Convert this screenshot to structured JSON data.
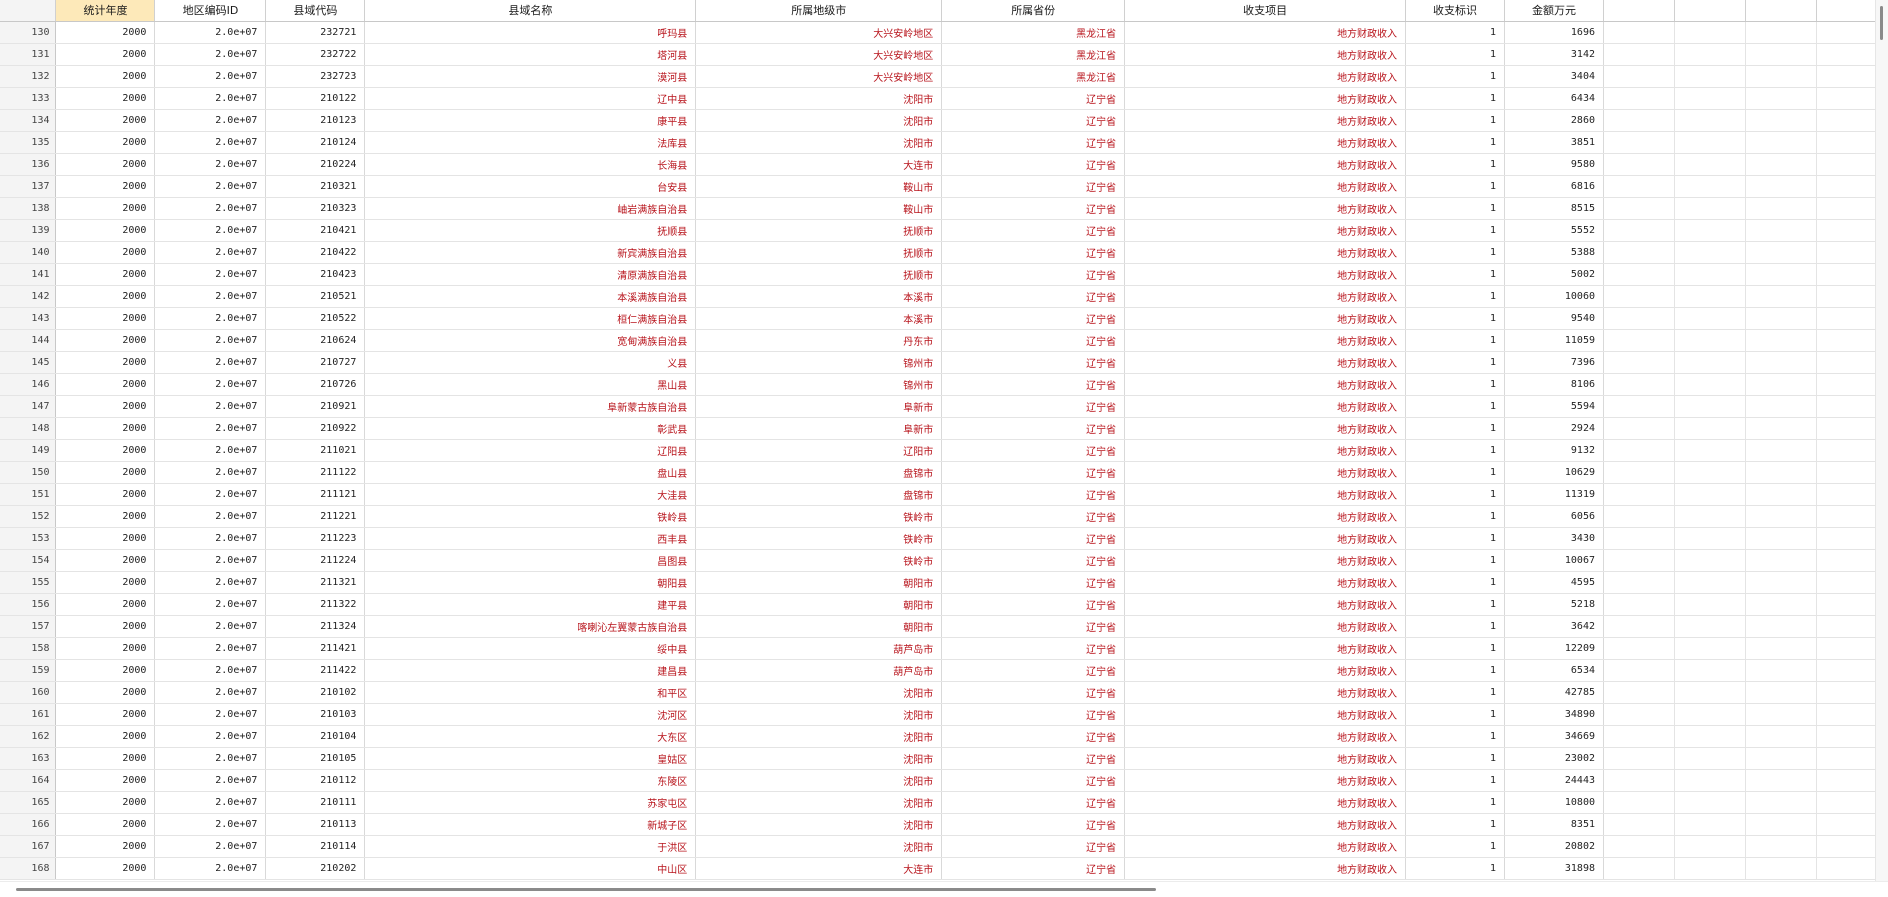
{
  "columns": [
    {
      "label": "统计年度",
      "kind": "num",
      "selected": true
    },
    {
      "label": "地区编码ID",
      "kind": "num"
    },
    {
      "label": "县域代码",
      "kind": "num"
    },
    {
      "label": "县域名称",
      "kind": "str"
    },
    {
      "label": "所属地级市",
      "kind": "str"
    },
    {
      "label": "所属省份",
      "kind": "str"
    },
    {
      "label": "收支项目",
      "kind": "str"
    },
    {
      "label": "收支标识",
      "kind": "num"
    },
    {
      "label": "金额万元",
      "kind": "num"
    }
  ],
  "extra_blank_columns": 4,
  "rows": [
    [
      "130",
      "2000",
      "2.0e+07",
      "232721",
      "呼玛县",
      "大兴安岭地区",
      "黑龙江省",
      "地方财政收入",
      "1",
      "1696"
    ],
    [
      "131",
      "2000",
      "2.0e+07",
      "232722",
      "塔河县",
      "大兴安岭地区",
      "黑龙江省",
      "地方财政收入",
      "1",
      "3142"
    ],
    [
      "132",
      "2000",
      "2.0e+07",
      "232723",
      "漠河县",
      "大兴安岭地区",
      "黑龙江省",
      "地方财政收入",
      "1",
      "3404"
    ],
    [
      "133",
      "2000",
      "2.0e+07",
      "210122",
      "辽中县",
      "沈阳市",
      "辽宁省",
      "地方财政收入",
      "1",
      "6434"
    ],
    [
      "134",
      "2000",
      "2.0e+07",
      "210123",
      "康平县",
      "沈阳市",
      "辽宁省",
      "地方财政收入",
      "1",
      "2860"
    ],
    [
      "135",
      "2000",
      "2.0e+07",
      "210124",
      "法库县",
      "沈阳市",
      "辽宁省",
      "地方财政收入",
      "1",
      "3851"
    ],
    [
      "136",
      "2000",
      "2.0e+07",
      "210224",
      "长海县",
      "大连市",
      "辽宁省",
      "地方财政收入",
      "1",
      "9580"
    ],
    [
      "137",
      "2000",
      "2.0e+07",
      "210321",
      "台安县",
      "鞍山市",
      "辽宁省",
      "地方财政收入",
      "1",
      "6816"
    ],
    [
      "138",
      "2000",
      "2.0e+07",
      "210323",
      "岫岩满族自治县",
      "鞍山市",
      "辽宁省",
      "地方财政收入",
      "1",
      "8515"
    ],
    [
      "139",
      "2000",
      "2.0e+07",
      "210421",
      "抚顺县",
      "抚顺市",
      "辽宁省",
      "地方财政收入",
      "1",
      "5552"
    ],
    [
      "140",
      "2000",
      "2.0e+07",
      "210422",
      "新宾满族自治县",
      "抚顺市",
      "辽宁省",
      "地方财政收入",
      "1",
      "5388"
    ],
    [
      "141",
      "2000",
      "2.0e+07",
      "210423",
      "清原满族自治县",
      "抚顺市",
      "辽宁省",
      "地方财政收入",
      "1",
      "5002"
    ],
    [
      "142",
      "2000",
      "2.0e+07",
      "210521",
      "本溪满族自治县",
      "本溪市",
      "辽宁省",
      "地方财政收入",
      "1",
      "10060"
    ],
    [
      "143",
      "2000",
      "2.0e+07",
      "210522",
      "桓仁满族自治县",
      "本溪市",
      "辽宁省",
      "地方财政收入",
      "1",
      "9540"
    ],
    [
      "144",
      "2000",
      "2.0e+07",
      "210624",
      "宽甸满族自治县",
      "丹东市",
      "辽宁省",
      "地方财政收入",
      "1",
      "11059"
    ],
    [
      "145",
      "2000",
      "2.0e+07",
      "210727",
      "义县",
      "锦州市",
      "辽宁省",
      "地方财政收入",
      "1",
      "7396"
    ],
    [
      "146",
      "2000",
      "2.0e+07",
      "210726",
      "黑山县",
      "锦州市",
      "辽宁省",
      "地方财政收入",
      "1",
      "8106"
    ],
    [
      "147",
      "2000",
      "2.0e+07",
      "210921",
      "阜新蒙古族自治县",
      "阜新市",
      "辽宁省",
      "地方财政收入",
      "1",
      "5594"
    ],
    [
      "148",
      "2000",
      "2.0e+07",
      "210922",
      "彰武县",
      "阜新市",
      "辽宁省",
      "地方财政收入",
      "1",
      "2924"
    ],
    [
      "149",
      "2000",
      "2.0e+07",
      "211021",
      "辽阳县",
      "辽阳市",
      "辽宁省",
      "地方财政收入",
      "1",
      "9132"
    ],
    [
      "150",
      "2000",
      "2.0e+07",
      "211122",
      "盘山县",
      "盘锦市",
      "辽宁省",
      "地方财政收入",
      "1",
      "10629"
    ],
    [
      "151",
      "2000",
      "2.0e+07",
      "211121",
      "大洼县",
      "盘锦市",
      "辽宁省",
      "地方财政收入",
      "1",
      "11319"
    ],
    [
      "152",
      "2000",
      "2.0e+07",
      "211221",
      "铁岭县",
      "铁岭市",
      "辽宁省",
      "地方财政收入",
      "1",
      "6056"
    ],
    [
      "153",
      "2000",
      "2.0e+07",
      "211223",
      "西丰县",
      "铁岭市",
      "辽宁省",
      "地方财政收入",
      "1",
      "3430"
    ],
    [
      "154",
      "2000",
      "2.0e+07",
      "211224",
      "昌图县",
      "铁岭市",
      "辽宁省",
      "地方财政收入",
      "1",
      "10067"
    ],
    [
      "155",
      "2000",
      "2.0e+07",
      "211321",
      "朝阳县",
      "朝阳市",
      "辽宁省",
      "地方财政收入",
      "1",
      "4595"
    ],
    [
      "156",
      "2000",
      "2.0e+07",
      "211322",
      "建平县",
      "朝阳市",
      "辽宁省",
      "地方财政收入",
      "1",
      "5218"
    ],
    [
      "157",
      "2000",
      "2.0e+07",
      "211324",
      "喀喇沁左翼蒙古族自治县",
      "朝阳市",
      "辽宁省",
      "地方财政收入",
      "1",
      "3642"
    ],
    [
      "158",
      "2000",
      "2.0e+07",
      "211421",
      "绥中县",
      "葫芦岛市",
      "辽宁省",
      "地方财政收入",
      "1",
      "12209"
    ],
    [
      "159",
      "2000",
      "2.0e+07",
      "211422",
      "建昌县",
      "葫芦岛市",
      "辽宁省",
      "地方财政收入",
      "1",
      "6534"
    ],
    [
      "160",
      "2000",
      "2.0e+07",
      "210102",
      "和平区",
      "沈阳市",
      "辽宁省",
      "地方财政收入",
      "1",
      "42785"
    ],
    [
      "161",
      "2000",
      "2.0e+07",
      "210103",
      "沈河区",
      "沈阳市",
      "辽宁省",
      "地方财政收入",
      "1",
      "34890"
    ],
    [
      "162",
      "2000",
      "2.0e+07",
      "210104",
      "大东区",
      "沈阳市",
      "辽宁省",
      "地方财政收入",
      "1",
      "34669"
    ],
    [
      "163",
      "2000",
      "2.0e+07",
      "210105",
      "皇姑区",
      "沈阳市",
      "辽宁省",
      "地方财政收入",
      "1",
      "23002"
    ],
    [
      "164",
      "2000",
      "2.0e+07",
      "210112",
      "东陵区",
      "沈阳市",
      "辽宁省",
      "地方财政收入",
      "1",
      "24443"
    ],
    [
      "165",
      "2000",
      "2.0e+07",
      "210111",
      "苏家屯区",
      "沈阳市",
      "辽宁省",
      "地方财政收入",
      "1",
      "10800"
    ],
    [
      "166",
      "2000",
      "2.0e+07",
      "210113",
      "新城子区",
      "沈阳市",
      "辽宁省",
      "地方财政收入",
      "1",
      "8351"
    ],
    [
      "167",
      "2000",
      "2.0e+07",
      "210114",
      "于洪区",
      "沈阳市",
      "辽宁省",
      "地方财政收入",
      "1",
      "20802"
    ],
    [
      "168",
      "2000",
      "2.0e+07",
      "210202",
      "中山区",
      "大连市",
      "辽宁省",
      "地方财政收入",
      "1",
      "31898"
    ]
  ]
}
